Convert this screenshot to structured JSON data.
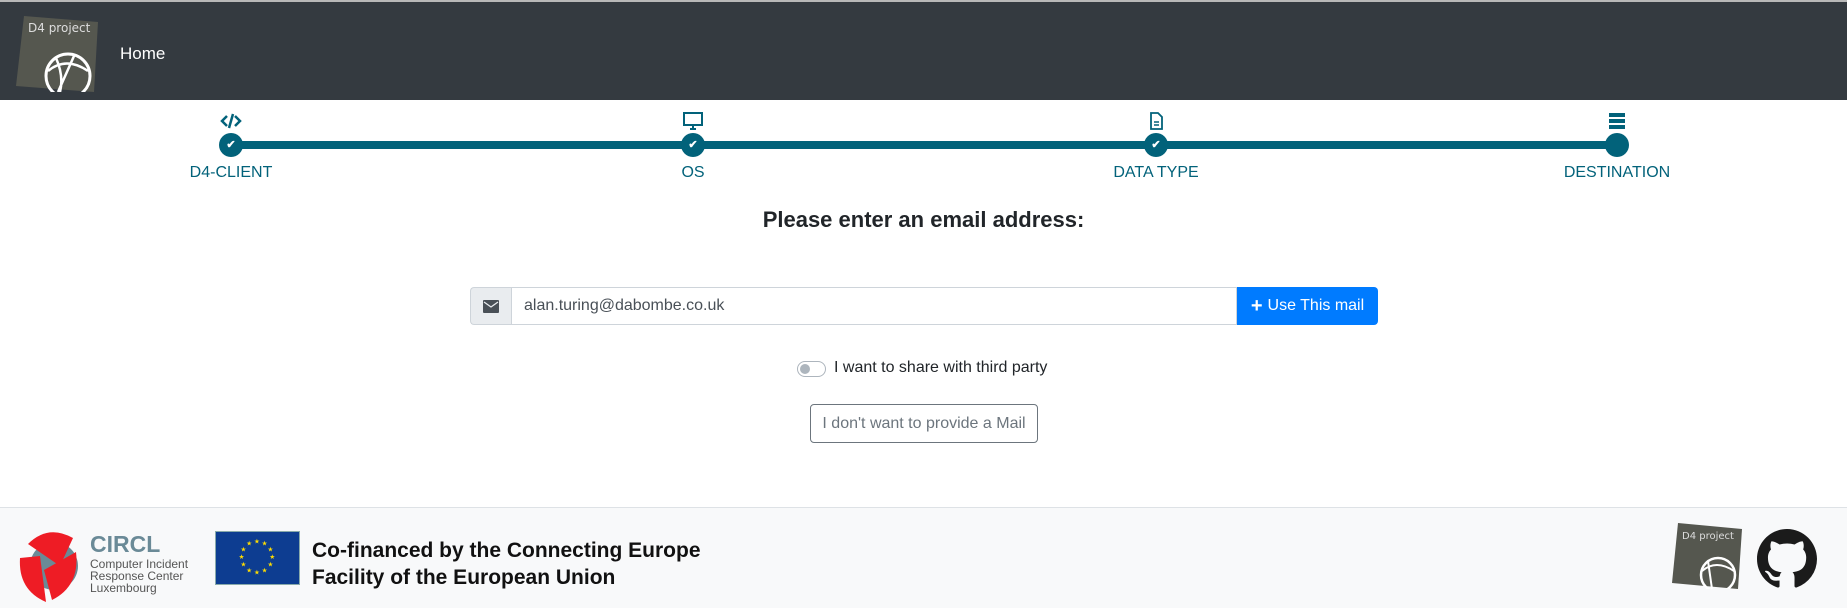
{
  "header": {
    "logo_text": "D4 project",
    "home_label": "Home"
  },
  "stepper": {
    "steps": [
      {
        "label": "D4-CLIENT",
        "icon": "code-icon",
        "done": true
      },
      {
        "label": "OS",
        "icon": "desktop-icon",
        "done": true
      },
      {
        "label": "DATA TYPE",
        "icon": "file-icon",
        "done": true
      },
      {
        "label": "DESTINATION",
        "icon": "server-icon",
        "done": false
      }
    ],
    "check": "✔",
    "accent": "#02627a"
  },
  "form": {
    "title": "Please enter an email address:",
    "email_value": "alan.turing@dabombe.co.uk",
    "use_label": "Use This mail",
    "share_label": "I want to share with third party",
    "share_enabled": false,
    "no_mail_label": "I don't want to provide a Mail"
  },
  "footer": {
    "circl_name": "CIRCL",
    "circl_sub1": "Computer Incident",
    "circl_sub2": "Response Center",
    "circl_sub3": "Luxembourg",
    "cofinanced_1": "Co-financed by the Connecting Europe",
    "cofinanced_2": "Facility of the European Union",
    "d4_logo_text": "D4 project"
  }
}
